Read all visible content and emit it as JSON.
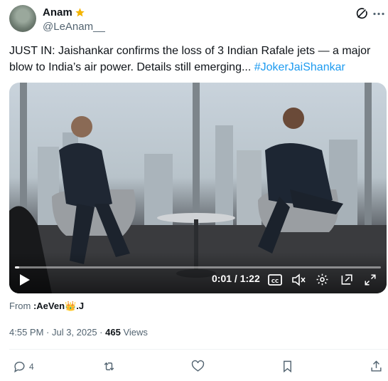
{
  "author": {
    "name": "Anam",
    "handle": "@LeAnam__",
    "badge_icon": "star-icon"
  },
  "tweet": {
    "text": "JUST IN: Jaishankar confirms the loss of 3 Indian Rafale jets — a major blow to India’s air power. Details still emerging... ",
    "hashtag": "#JokerJaiShankar"
  },
  "video": {
    "current_time": "0:01",
    "separator": " / ",
    "duration": "1:22",
    "progress_fraction": 0.012
  },
  "source": {
    "label": "From ",
    "name": ":AeVen👑.J"
  },
  "meta": {
    "time": "4:55 PM · Jul 3, 2025 · ",
    "views_count": "465",
    "views_label": " Views"
  },
  "actions": {
    "reply_count": "4"
  },
  "colors": {
    "accent": "#1d9bf0",
    "secondary_text": "#536471",
    "primary_text": "#0f1419",
    "star": "#f4b400"
  }
}
